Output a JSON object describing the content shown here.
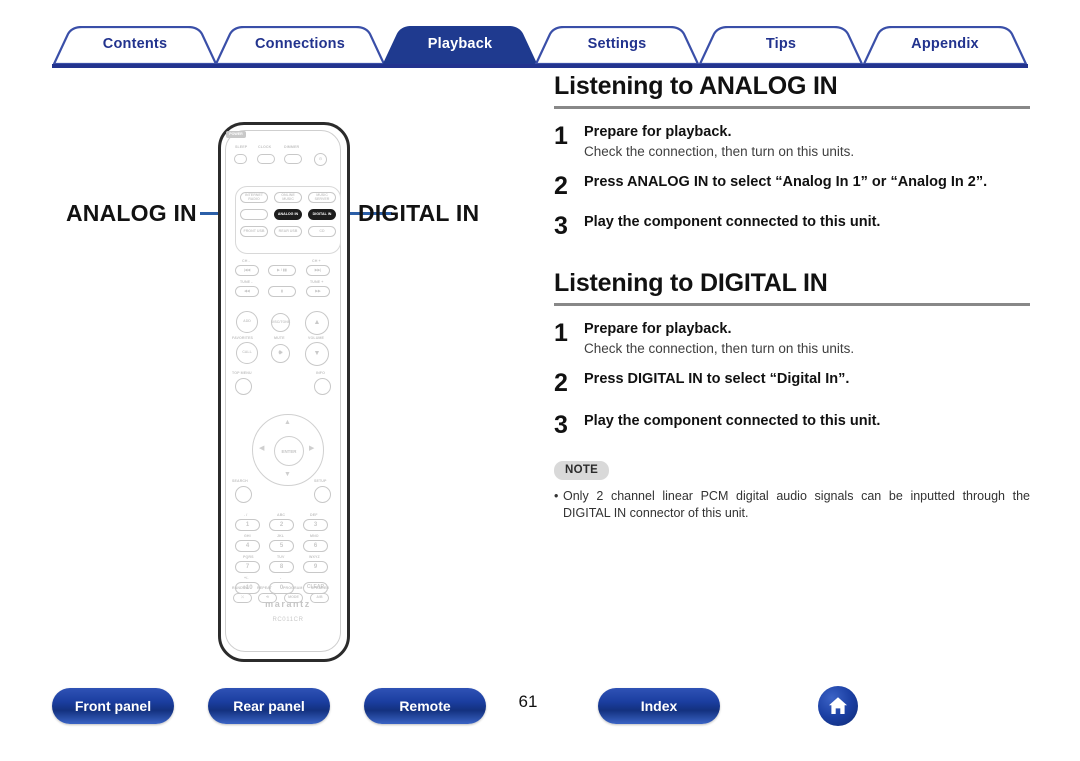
{
  "tabs": [
    {
      "label": "Contents",
      "active": false
    },
    {
      "label": "Connections",
      "active": false
    },
    {
      "label": "Playback",
      "active": true
    },
    {
      "label": "Settings",
      "active": false
    },
    {
      "label": "Tips",
      "active": false
    },
    {
      "label": "Appendix",
      "active": false
    }
  ],
  "colors": {
    "tab_active_bg": "#1f3a8f",
    "tab_border": "#3a4fa8",
    "tab_text": "#22338e",
    "rule": "#22338e",
    "callout_line": "#2b5fa8",
    "heading_rule": "#888888",
    "note_badge_bg": "#d9d9d9"
  },
  "figure": {
    "callout_left_label": "ANALOG IN",
    "callout_right_label": "DIGITAL IN",
    "brand": "marantz",
    "model": "RC011CR",
    "top_row": [
      {
        "label": "SLEEP"
      },
      {
        "label": "CLOCK"
      },
      {
        "label": "DIMMER"
      },
      {
        "label": "POWER"
      }
    ],
    "input_buttons": [
      {
        "label": "INTERNET RADIO"
      },
      {
        "label": "ONLINE MUSIC"
      },
      {
        "label": "MUSIC SERVER"
      },
      {
        "label": "ANALOG IN"
      },
      {
        "label": "DIGITAL IN"
      },
      {
        "label": "FRONT USB"
      },
      {
        "label": "REAR USB"
      },
      {
        "label": "CD"
      }
    ],
    "transport_labels": {
      "ch_minus": "CH -",
      "ch_plus": "CH +",
      "tune_minus": "TUNE -",
      "tune_plus": "TUNE +"
    },
    "transport_buttons": [
      "|◀◀",
      "▶ / ▮▮",
      "▶▶|",
      "◀◀",
      "▮",
      "▶▶"
    ],
    "mid_buttons": [
      {
        "label": "ADD"
      },
      {
        "label": "DISC/TONE"
      },
      {
        "label": "▲"
      },
      {
        "label": "CALL"
      },
      {
        "label": "MUTE"
      },
      {
        "label": "▼"
      }
    ],
    "mid_captions": {
      "favorites": "FAVORITES",
      "mute": "MUTE",
      "volume": "VOLUME",
      "top_menu": "TOP MENU",
      "info": "INFO",
      "search": "SEARCH",
      "setup": "SETUP"
    },
    "cursor": {
      "enter": "ENTER",
      "up": "▲",
      "down": "▼",
      "left": "◀",
      "right": "▶"
    },
    "keypad": [
      {
        "key": "1",
        "sub": ". /"
      },
      {
        "key": "2",
        "sub": "ABC"
      },
      {
        "key": "3",
        "sub": "DEF"
      },
      {
        "key": "4",
        "sub": "GHI"
      },
      {
        "key": "5",
        "sub": "JKL"
      },
      {
        "key": "6",
        "sub": "MNO"
      },
      {
        "key": "7",
        "sub": "PQRS"
      },
      {
        "key": "8",
        "sub": "TUV"
      },
      {
        "key": "9",
        "sub": "WXYZ"
      },
      {
        "key": "+10",
        "sub": "+/-"
      },
      {
        "key": "0",
        "sub": "-"
      },
      {
        "key": "CLEAR",
        "sub": ""
      }
    ],
    "bottom_row": [
      {
        "caption": "RANDOM",
        "glyph": "⤫"
      },
      {
        "caption": "REPEAT",
        "glyph": "⟲"
      },
      {
        "caption": "PROGRAM",
        "glyph": "MODE"
      },
      {
        "caption": "SPEAKER",
        "glyph": "A/B"
      }
    ]
  },
  "content": {
    "sections": [
      {
        "title": "Listening to ANALOG IN",
        "steps": [
          {
            "num": "1",
            "title": "Prepare for playback.",
            "desc": "Check the connection, then turn on this units."
          },
          {
            "num": "2",
            "title": "Press ANALOG IN to select “Analog In 1” or “Analog In 2”.",
            "desc": ""
          },
          {
            "num": "3",
            "title": "Play the component connected to this unit.",
            "desc": ""
          }
        ]
      },
      {
        "title": "Listening to DIGITAL IN",
        "steps": [
          {
            "num": "1",
            "title": "Prepare for playback.",
            "desc": "Check the connection, then turn on this units."
          },
          {
            "num": "2",
            "title": "Press DIGITAL IN to select “Digital In”.",
            "desc": ""
          },
          {
            "num": "3",
            "title": "Play the component connected to this unit.",
            "desc": ""
          }
        ]
      }
    ],
    "note": {
      "badge": "NOTE",
      "bullet": "•",
      "text": "Only 2 channel linear PCM digital audio signals can be inputted through the DIGITAL IN connector of this unit."
    }
  },
  "footer": {
    "buttons": [
      {
        "label": "Front panel"
      },
      {
        "label": "Rear panel"
      },
      {
        "label": "Remote"
      },
      {
        "label": "Index"
      }
    ],
    "page_number": "61",
    "home_icon": "home-icon"
  }
}
